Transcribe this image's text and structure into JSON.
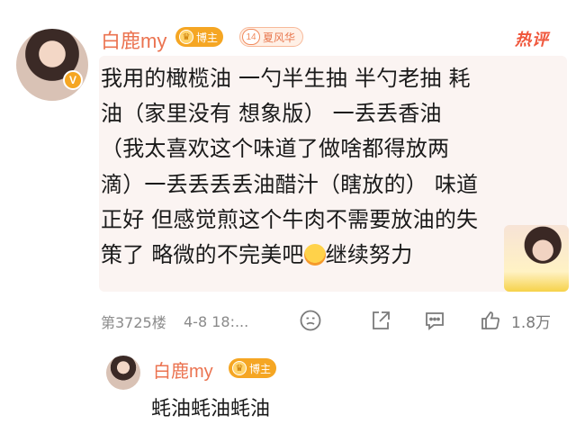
{
  "comment": {
    "username": "白鹿my",
    "blogger_badge_label": "博主",
    "fan_badge": {
      "level": "14",
      "label": "夏风华"
    },
    "hot_label": "热评",
    "verify_icon": "V",
    "text_lines": [
      "我用的橄榄油 一勺半生抽 半勺老抽 耗",
      "油（家里没有 想象版） 一丢丢香油",
      "（我太喜欢这个味道了做啥都得放两",
      "滴）一丢丢丢丢油醋汁（瞎放的） 味道",
      "正好 但感觉煎这个牛肉不需要放油的失",
      "策了 略微的不完美吧"
    ],
    "text_tail": "继续努力",
    "floor": "第3725楼",
    "time": "4-8 18:...",
    "like_count": "1.8万",
    "icons": [
      "emoji-icon",
      "share-icon",
      "reply-icon",
      "like-icon"
    ]
  },
  "reply": {
    "username": "白鹿my",
    "blogger_badge_label": "博主",
    "text": "蚝油蚝油蚝油"
  },
  "colors": {
    "username": "#eb7350",
    "badge": "#f5a623",
    "hot": "#f0573c",
    "bubble": "#fbf4f2",
    "meta": "#8a8a8a"
  }
}
